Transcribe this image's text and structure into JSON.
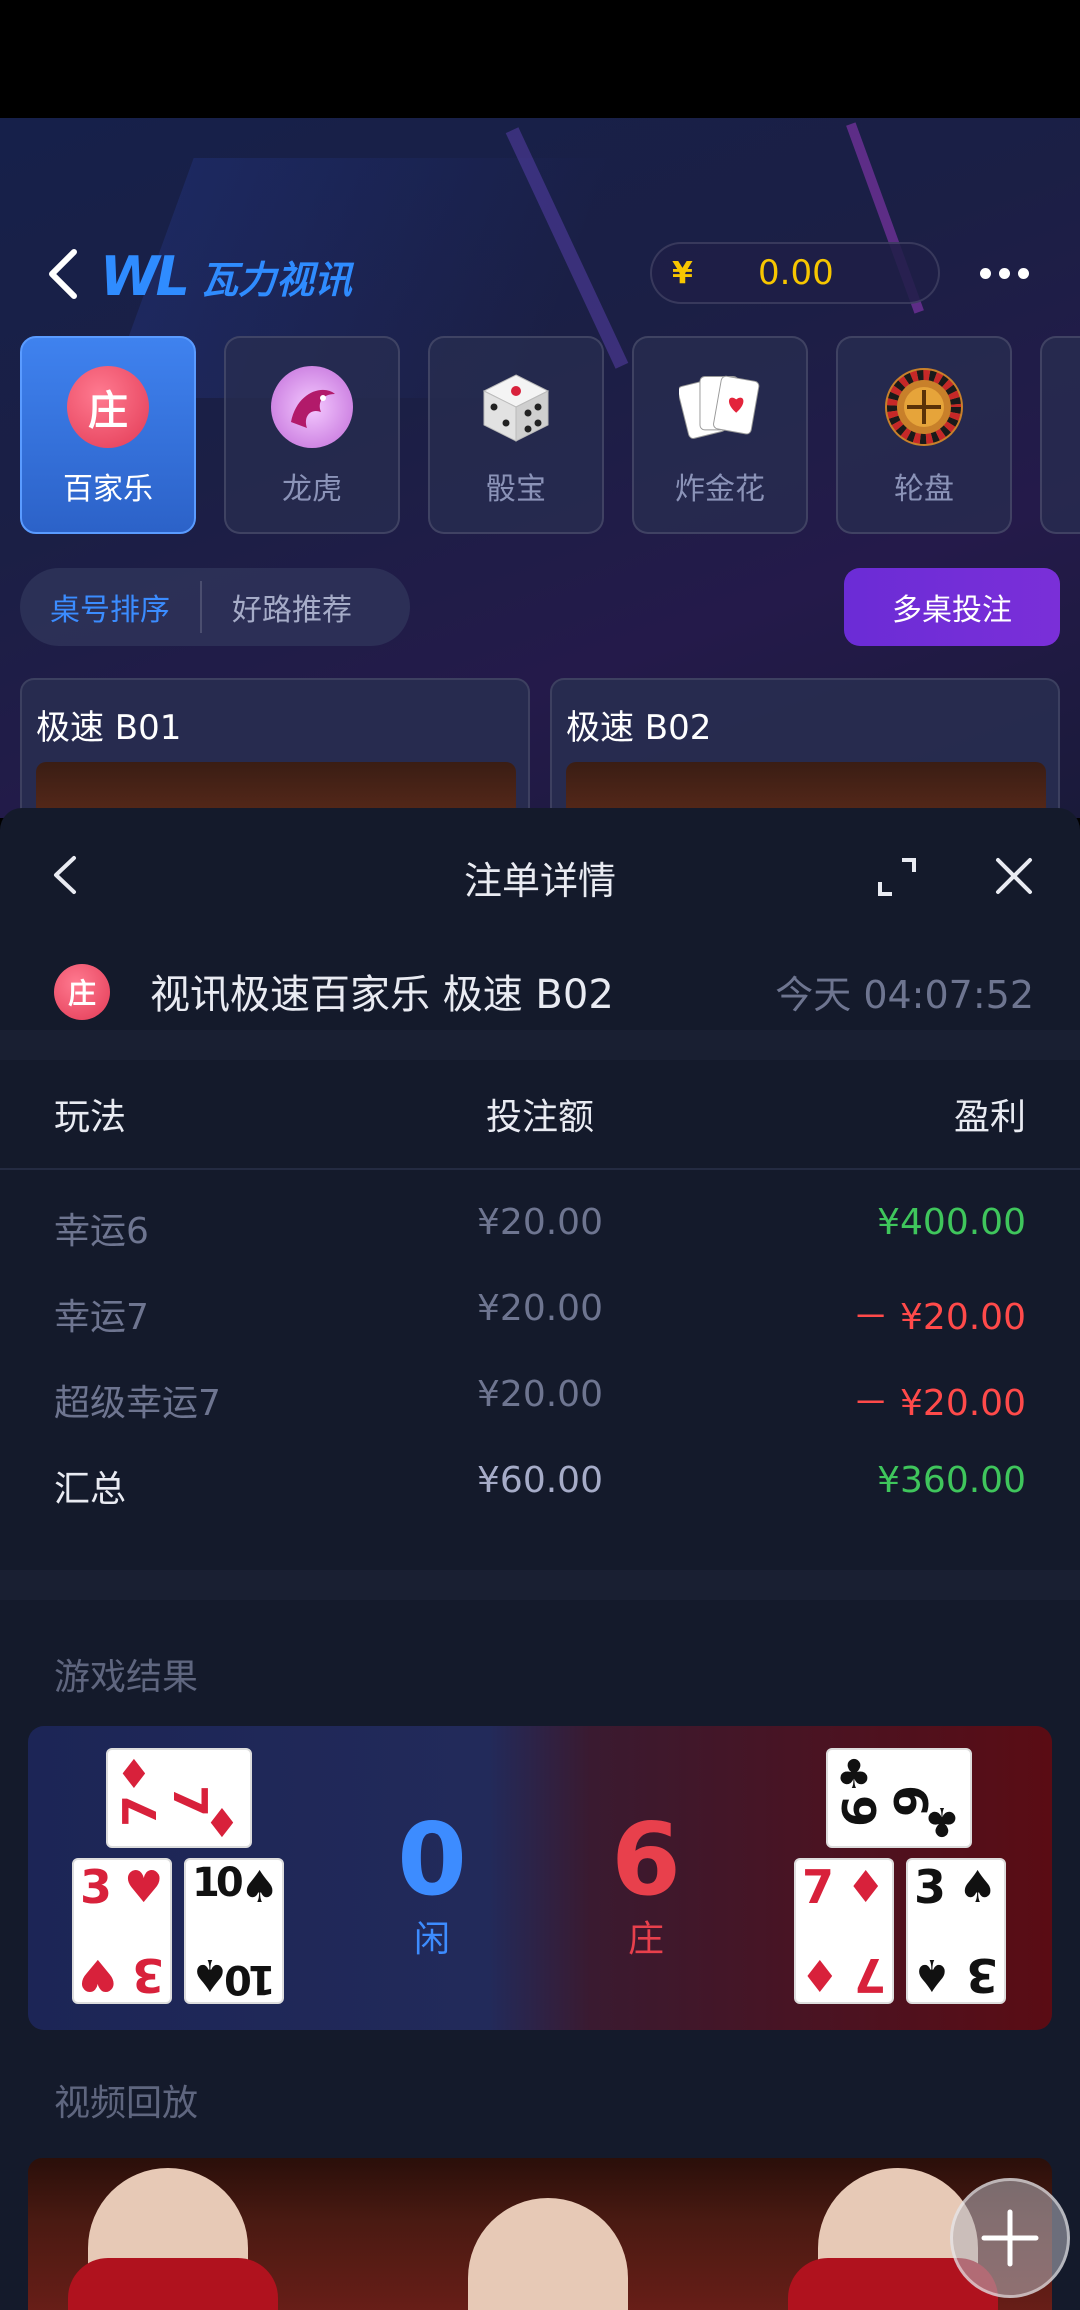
{
  "header": {
    "logo_mark": "WL",
    "logo_text": "瓦力视讯",
    "balance_currency": "¥",
    "balance_amount": "0.00"
  },
  "games": [
    {
      "label": "百家乐",
      "icon_char": "庄",
      "active": true
    },
    {
      "label": "龙虎",
      "icon": "dragon-icon"
    },
    {
      "label": "骰宝",
      "icon": "dice-icon"
    },
    {
      "label": "炸金花",
      "icon": "cards-icon"
    },
    {
      "label": "轮盘",
      "icon": "roulette-icon"
    }
  ],
  "sort_tabs": [
    "桌号排序",
    "好路推荐"
  ],
  "multi_table_button": "多桌投注",
  "tables": [
    "极速 B01",
    "极速 B02"
  ],
  "sheet": {
    "title": "注单详情",
    "badge": "庄",
    "bet_title": "视讯极速百家乐 极速 B02",
    "bet_time": "今天 04:07:52",
    "columns": [
      "玩法",
      "投注额",
      "盈利"
    ],
    "rows": [
      {
        "play": "幸运6",
        "amount": "¥20.00",
        "profit": "¥400.00",
        "status": "win"
      },
      {
        "play": "幸运7",
        "amount": "¥20.00",
        "profit": "－ ¥20.00",
        "status": "lose"
      },
      {
        "play": "超级幸运7",
        "amount": "¥20.00",
        "profit": "－ ¥20.00",
        "status": "lose"
      }
    ],
    "summary": {
      "play": "汇总",
      "amount": "¥60.00",
      "profit": "¥360.00"
    },
    "result_label": "游戏结果",
    "player": {
      "score": "0",
      "label": "闲",
      "cards": [
        {
          "rank": "7",
          "suit": "♦",
          "color": "red"
        },
        {
          "rank": "3",
          "suit": "♥",
          "color": "red"
        },
        {
          "rank": "10",
          "suit": "♠",
          "color": "black"
        }
      ]
    },
    "banker": {
      "score": "6",
      "label": "庄",
      "cards": [
        {
          "rank": "6",
          "suit": "♣",
          "color": "black"
        },
        {
          "rank": "7",
          "suit": "♦",
          "color": "red"
        },
        {
          "rank": "3",
          "suit": "♠",
          "color": "black"
        }
      ]
    },
    "replay_label": "视频回放"
  },
  "colors": {
    "accent": "#3b8cff",
    "win": "#3fc65c",
    "lose": "#ff4a4a",
    "balance": "#f7c600",
    "multi": "#6b2cd6"
  }
}
